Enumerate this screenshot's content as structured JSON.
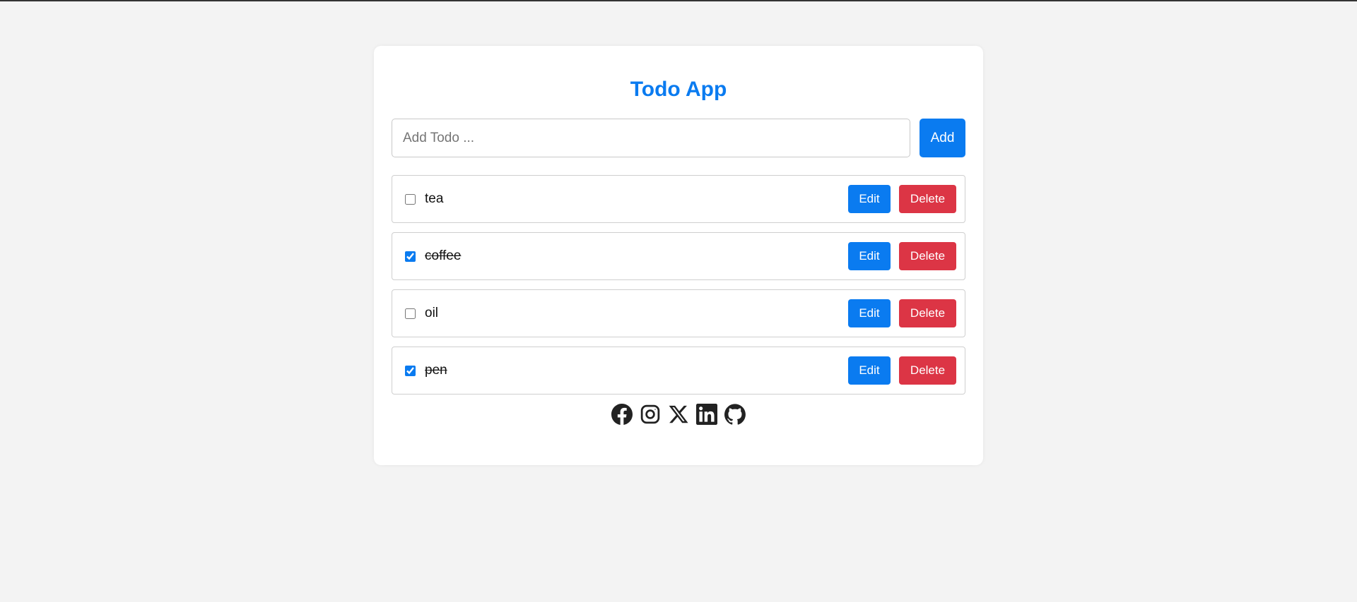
{
  "app": {
    "title": "Todo App"
  },
  "add_form": {
    "placeholder": "Add Todo ...",
    "value": "",
    "add_label": "Add"
  },
  "todos": [
    {
      "text": "tea",
      "done": false,
      "edit_label": "Edit",
      "delete_label": "Delete"
    },
    {
      "text": "coffee",
      "done": true,
      "edit_label": "Edit",
      "delete_label": "Delete"
    },
    {
      "text": "oil",
      "done": false,
      "edit_label": "Edit",
      "delete_label": "Delete"
    },
    {
      "text": "pen",
      "done": true,
      "edit_label": "Edit",
      "delete_label": "Delete"
    }
  ],
  "social": [
    {
      "icon": "facebook-icon"
    },
    {
      "icon": "instagram-icon"
    },
    {
      "icon": "x-icon"
    },
    {
      "icon": "linkedin-icon"
    },
    {
      "icon": "github-icon"
    }
  ],
  "colors": {
    "accent": "#0a7bf0",
    "danger": "#dc3545",
    "background": "#f3f3f3",
    "card": "#ffffff"
  }
}
